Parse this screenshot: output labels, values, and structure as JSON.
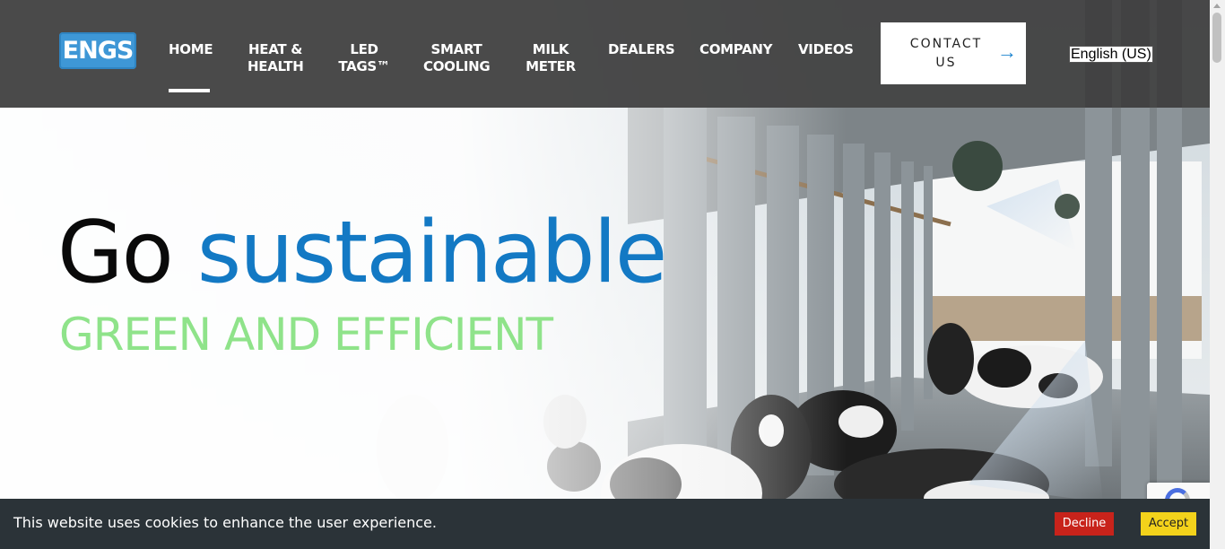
{
  "header": {
    "logo_text": "ENGS",
    "nav": [
      {
        "label": "HOME",
        "active": true
      },
      {
        "label": "HEAT &\nHEALTH"
      },
      {
        "label": "LED\nTAGS™"
      },
      {
        "label": "SMART\nCOOLING"
      },
      {
        "label": "MILK\nMETER"
      },
      {
        "label": "DEALERS"
      },
      {
        "label": "COMPANY"
      },
      {
        "label": "VIDEOS"
      }
    ],
    "contact_label": "CONTACT\nUS",
    "contact_icon": "arrow-right-icon",
    "language": "English (US)"
  },
  "hero": {
    "headline_word1": "Go",
    "headline_word2": "sustainable",
    "subheadline": "GREEN AND EFFICIENT",
    "background": "dairy-barn-with-cows-photo"
  },
  "cookie_banner": {
    "text": "This website uses cookies to enhance the user experience.",
    "decline_label": "Decline",
    "accept_label": "Accept"
  },
  "colors": {
    "header_bg": "#3c3c3c",
    "brand_blue": "#1379c4",
    "logo_blue": "#3e97d6",
    "green": "#8fe38a",
    "cookie_bg": "#2b3338",
    "decline": "#c8231b",
    "accept": "#f3d21b"
  }
}
